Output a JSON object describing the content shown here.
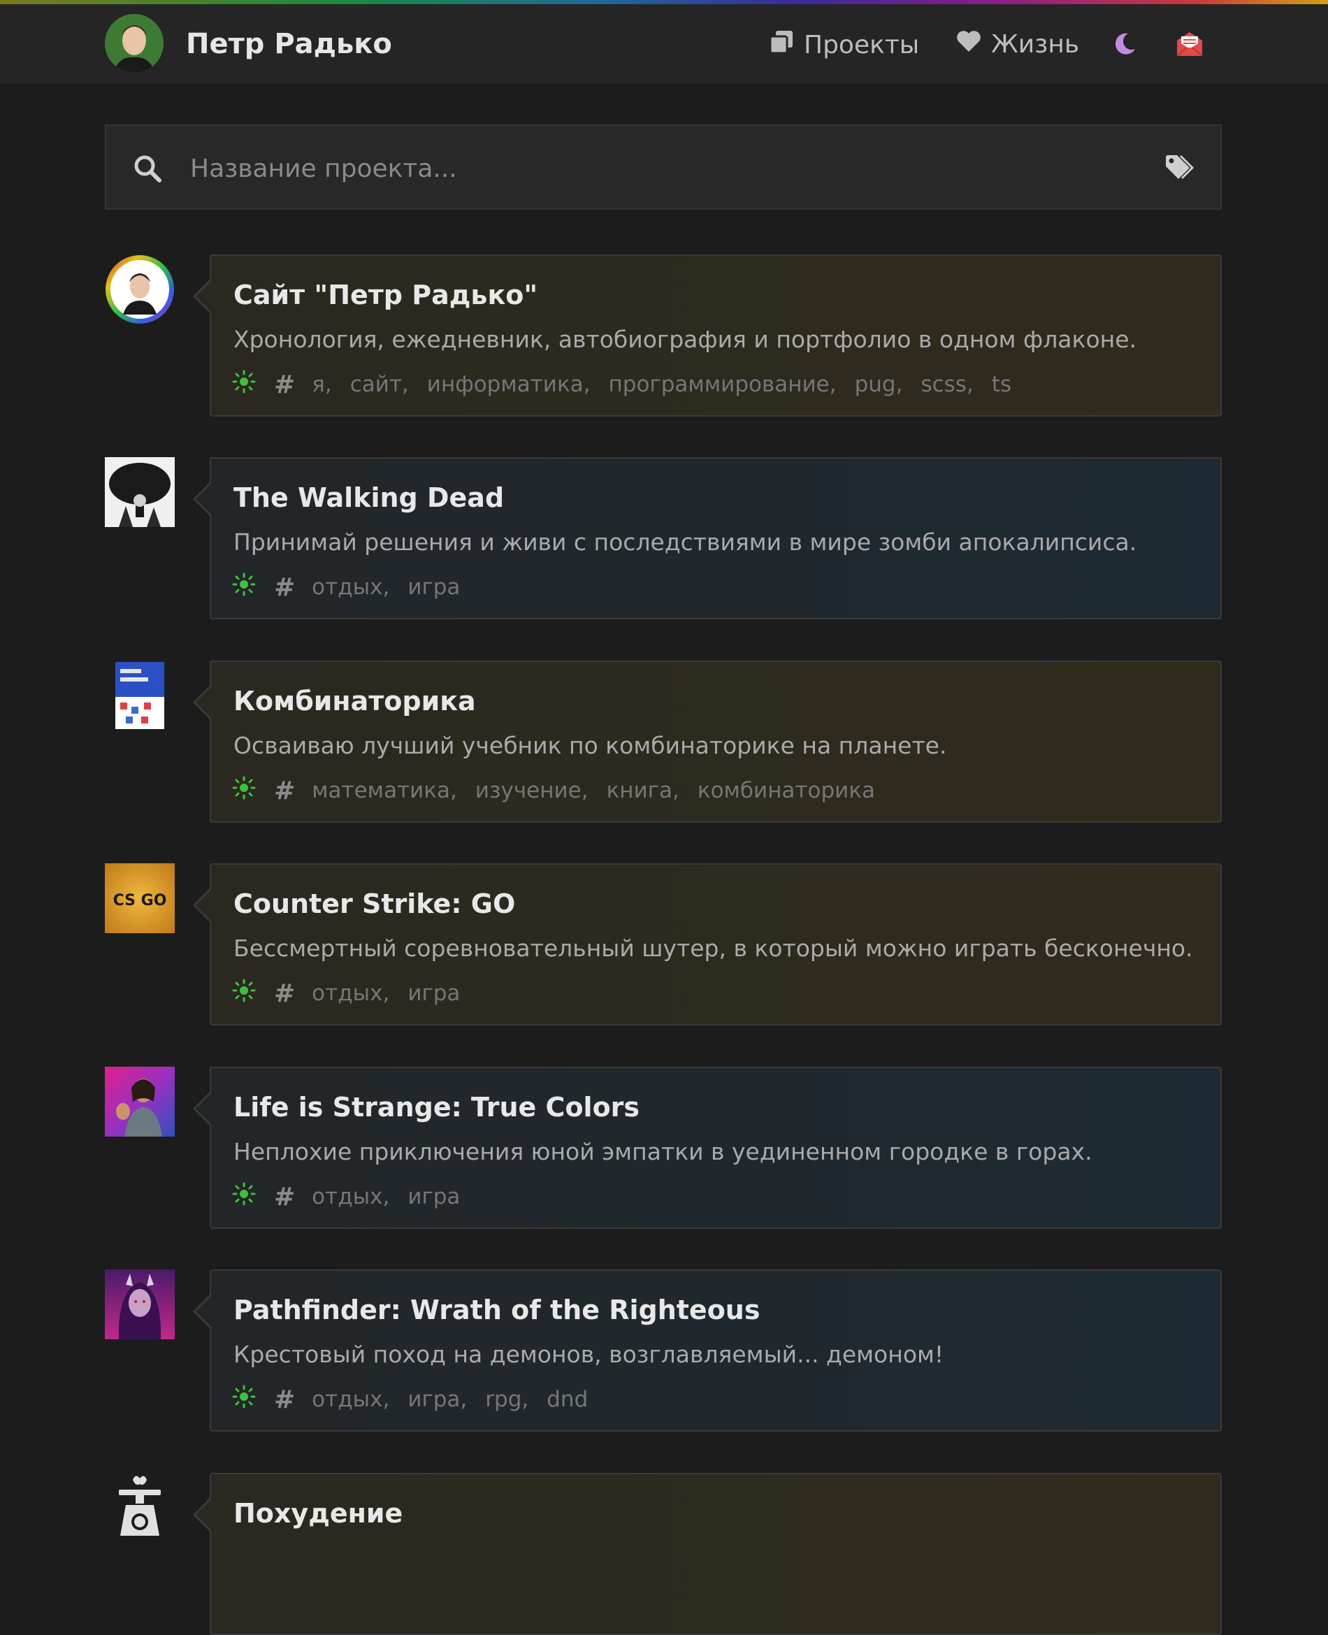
{
  "header": {
    "name": "Петр Радько",
    "nav": [
      {
        "label": "Проекты",
        "icon": "copy-icon"
      },
      {
        "label": "Жизнь",
        "icon": "heart-icon"
      }
    ],
    "theme_icon": "moon-icon",
    "mail_icon": "envelope-open-icon",
    "colors": {
      "moon": "#c58be0",
      "mail": "#e04a4a"
    }
  },
  "search": {
    "placeholder": "Название проекта...",
    "icon": "search-icon",
    "tags_icon": "tags-icon"
  },
  "projects": [
    {
      "title": "Сайт \"Петр Радько\"",
      "description": "Хронология, ежедневник, автобиография и портфолио в одном флаконе.",
      "status_icon": "sun-icon",
      "tags": [
        "я,",
        "сайт,",
        "информатика,",
        "программирование,",
        "pug,",
        "scss,",
        "ts"
      ]
    },
    {
      "title": "The Walking Dead",
      "description": "Принимай решения и живи с последствиями в мире зомби апокалипсиса.",
      "status_icon": "sun-icon",
      "tags": [
        "отдых,",
        "игра"
      ]
    },
    {
      "title": "Комбинаторика",
      "description": "Осваиваю лучший учебник по комбинаторике на планете.",
      "status_icon": "sun-icon",
      "tags": [
        "математика,",
        "изучение,",
        "книга,",
        "комбинаторика"
      ]
    },
    {
      "title": "Counter Strike: GO",
      "description": "Бессмертный соревновательный шутер, в который можно играть бесконечно.",
      "status_icon": "sun-icon",
      "tags": [
        "отдых,",
        "игра"
      ],
      "logo_text": "CS GO"
    },
    {
      "title": "Life is Strange: True Colors",
      "description": "Неплохие приключения юной эмпатки в уединенном городке в горах.",
      "status_icon": "sun-icon",
      "tags": [
        "отдых,",
        "игра"
      ]
    },
    {
      "title": "Pathfinder: Wrath of the Righteous",
      "description": "Крестовый поход на демонов, возглавляемый... демоном!",
      "status_icon": "sun-icon",
      "tags": [
        "отдых,",
        "игра,",
        "rpg,",
        "dnd"
      ]
    },
    {
      "title": "Похудение",
      "description": "",
      "status_icon": "sun-icon",
      "tags": []
    }
  ]
}
